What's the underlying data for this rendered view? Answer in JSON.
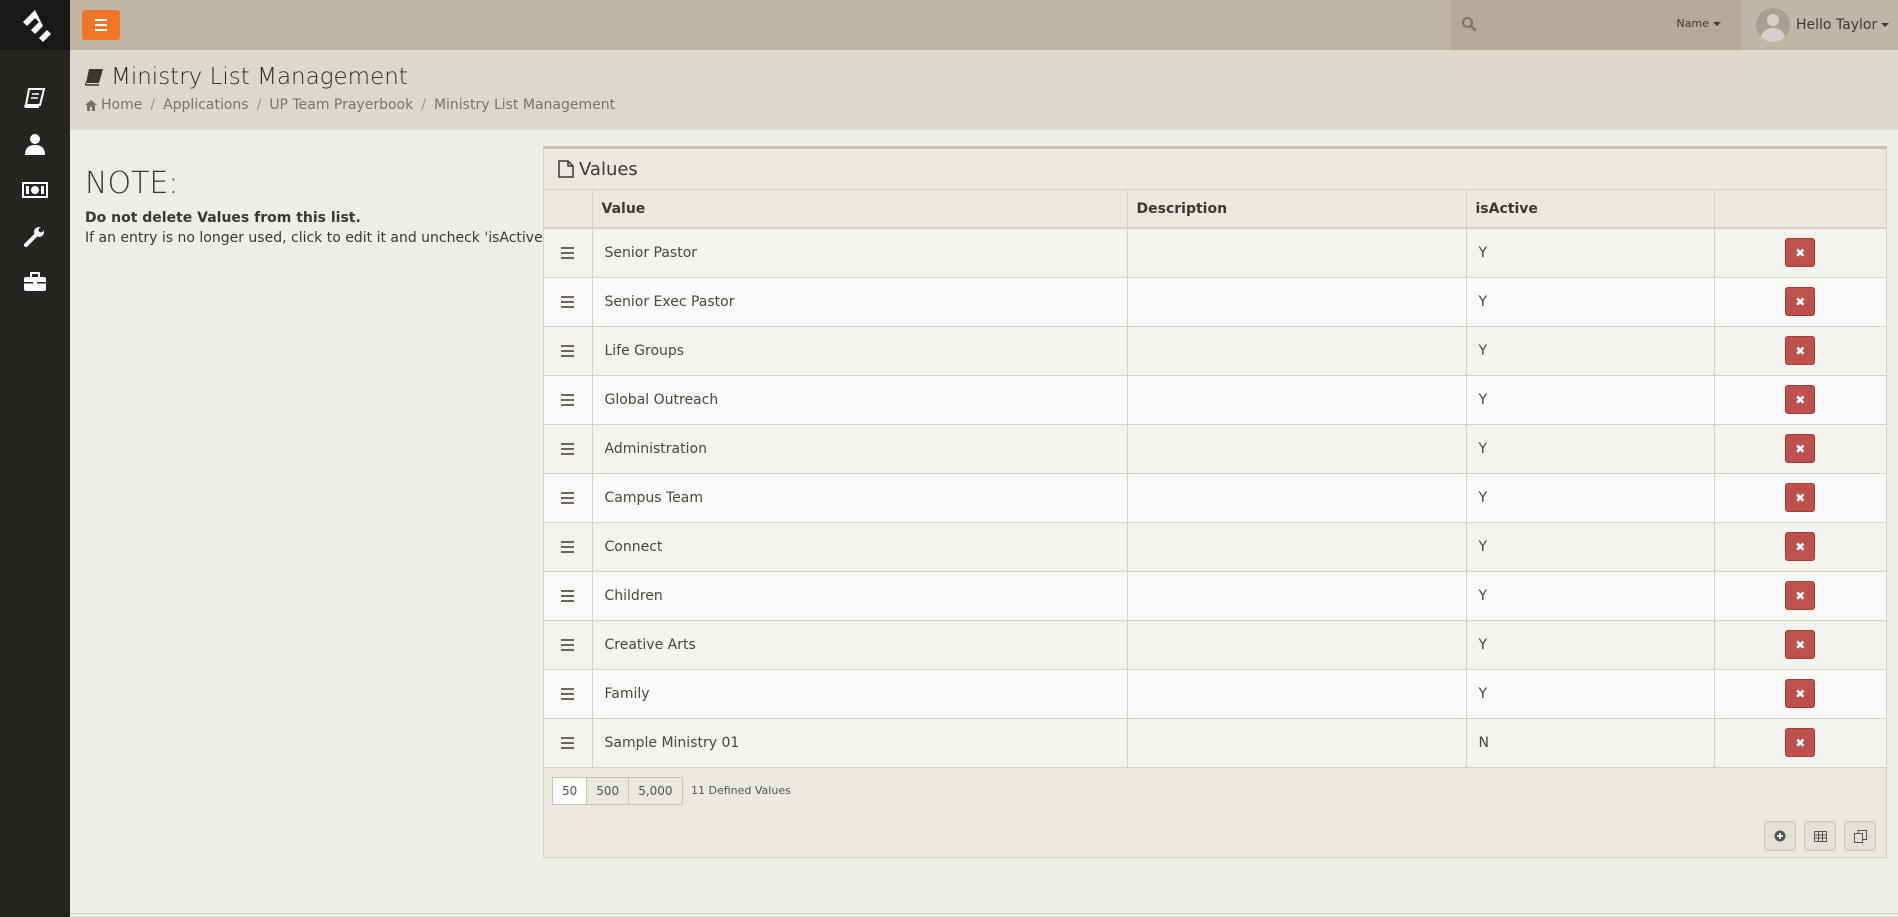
{
  "sidebar": {
    "logo_icon": "rock-logo-icon",
    "items": [
      {
        "icon": "book-icon"
      },
      {
        "icon": "user-icon"
      },
      {
        "icon": "money-icon"
      },
      {
        "icon": "wrench-icon"
      },
      {
        "icon": "briefcase-icon"
      }
    ]
  },
  "topbar": {
    "menu_icon": "hamburger-icon",
    "search": {
      "placeholder": "",
      "filter_label": "Name"
    },
    "user": {
      "greeting": "Hello Taylor"
    }
  },
  "page": {
    "title": "Ministry List Management",
    "breadcrumb": [
      "Home",
      "Applications",
      "UP Team Prayerbook",
      "Ministry List Management"
    ]
  },
  "note": {
    "title": "NOTE:",
    "bold_line": "Do not delete Values from this list.",
    "text": "If an entry is no longer used, click to edit it and uncheck 'isActive'."
  },
  "panel": {
    "title": "Values",
    "columns": [
      "",
      "Value",
      "Description",
      "isActive",
      ""
    ],
    "rows": [
      {
        "value": "Senior Pastor",
        "description": "",
        "is_active": "Y"
      },
      {
        "value": "Senior Exec Pastor",
        "description": "",
        "is_active": "Y"
      },
      {
        "value": "Life Groups",
        "description": "",
        "is_active": "Y"
      },
      {
        "value": "Global Outreach",
        "description": "",
        "is_active": "Y"
      },
      {
        "value": "Administration",
        "description": "",
        "is_active": "Y"
      },
      {
        "value": "Campus Team",
        "description": "",
        "is_active": "Y"
      },
      {
        "value": "Connect",
        "description": "",
        "is_active": "Y"
      },
      {
        "value": "Children",
        "description": "",
        "is_active": "Y"
      },
      {
        "value": "Creative Arts",
        "description": "",
        "is_active": "Y"
      },
      {
        "value": "Family",
        "description": "",
        "is_active": "Y"
      },
      {
        "value": "Sample Ministry 01",
        "description": "",
        "is_active": "N"
      }
    ],
    "delete_label": "✖",
    "page_sizes": [
      "50",
      "500",
      "5,000"
    ],
    "active_page_size": "50",
    "count_text": "11 Defined Values"
  },
  "colors": {
    "accent": "#ee7624",
    "danger": "#c0504d",
    "sidebar": "#272522"
  }
}
